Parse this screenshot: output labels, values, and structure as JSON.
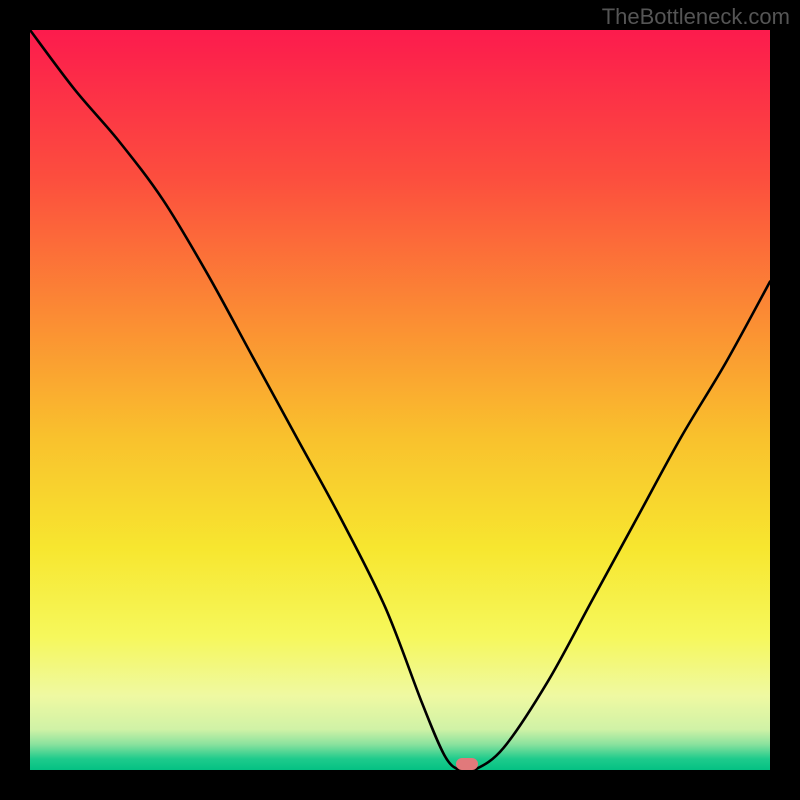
{
  "watermark": "TheBottleneck.com",
  "chart_data": {
    "type": "line",
    "title": "",
    "xlabel": "",
    "ylabel": "",
    "xlim": [
      0,
      100
    ],
    "ylim": [
      0,
      100
    ],
    "grid": false,
    "legend": false,
    "series": [
      {
        "name": "bottleneck-curve",
        "x": [
          0,
          6,
          12,
          18,
          24,
          30,
          36,
          42,
          48,
          53,
          56,
          58,
          60,
          64,
          70,
          76,
          82,
          88,
          94,
          100
        ],
        "values": [
          100,
          92,
          85,
          77,
          67,
          56,
          45,
          34,
          22,
          9,
          2,
          0,
          0,
          3,
          12,
          23,
          34,
          45,
          55,
          66
        ]
      }
    ],
    "annotations": [
      {
        "name": "min-marker",
        "x": 59,
        "y": 0.8,
        "color": "#e1797b"
      }
    ],
    "background_gradient_stops": [
      {
        "offset": 0,
        "color": "#fc1b4d"
      },
      {
        "offset": 0.2,
        "color": "#fc4e3e"
      },
      {
        "offset": 0.4,
        "color": "#fb9033"
      },
      {
        "offset": 0.55,
        "color": "#f9c12d"
      },
      {
        "offset": 0.7,
        "color": "#f7e62f"
      },
      {
        "offset": 0.82,
        "color": "#f6f85c"
      },
      {
        "offset": 0.9,
        "color": "#eff9a2"
      },
      {
        "offset": 0.945,
        "color": "#d0f2a6"
      },
      {
        "offset": 0.965,
        "color": "#8be29e"
      },
      {
        "offset": 0.985,
        "color": "#1ecb8c"
      },
      {
        "offset": 1.0,
        "color": "#04c183"
      }
    ]
  }
}
